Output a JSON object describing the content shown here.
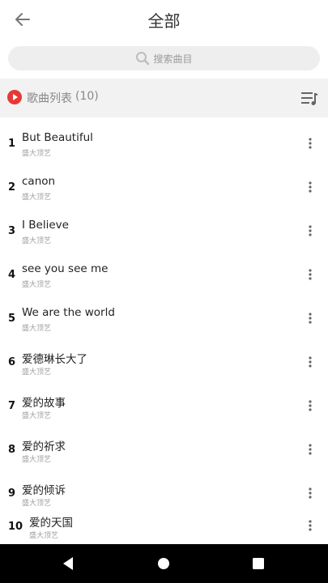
{
  "header": {
    "title": "全部"
  },
  "search": {
    "placeholder": "搜索曲目"
  },
  "list_header": {
    "title": "歌曲列表",
    "count": "(10)"
  },
  "songs": [
    {
      "num": "1",
      "name": "But Beautiful",
      "artist": "盛大顶艺"
    },
    {
      "num": "2",
      "name": "canon",
      "artist": "盛大顶艺"
    },
    {
      "num": "3",
      "name": "I Believe",
      "artist": "盛大顶艺"
    },
    {
      "num": "4",
      "name": "see you see me",
      "artist": "盛大顶艺"
    },
    {
      "num": "5",
      "name": "We are the world",
      "artist": "盛大顶艺"
    },
    {
      "num": "6",
      "name": "爱德琳长大了",
      "artist": "盛大顶艺"
    },
    {
      "num": "7",
      "name": "爱的故事",
      "artist": "盛大顶艺"
    },
    {
      "num": "8",
      "name": "爱的祈求",
      "artist": "盛大顶艺"
    },
    {
      "num": "9",
      "name": "爱的倾诉",
      "artist": "盛大顶艺"
    },
    {
      "num": "10",
      "name": "爱的天国",
      "artist": "盛大顶艺"
    }
  ],
  "colors": {
    "accent": "#e53935",
    "list_header_bg": "#f2f2f2",
    "search_bg": "#eeeeee"
  },
  "icons": {
    "back": "arrow-left-icon",
    "search": "search-icon",
    "play": "play-circle-icon",
    "list_menu": "playlist-menu-icon",
    "more": "more-vertical-icon"
  }
}
